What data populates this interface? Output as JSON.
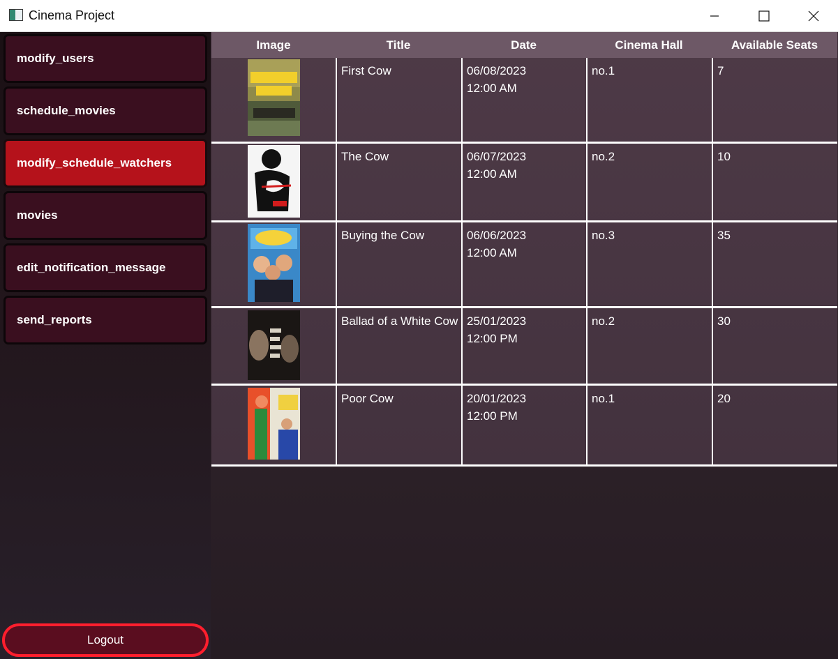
{
  "window": {
    "title": "Cinema Project"
  },
  "sidebar": {
    "items": [
      {
        "label": "modify_users",
        "active": false
      },
      {
        "label": "schedule_movies",
        "active": false
      },
      {
        "label": "modify_schedule_watchers",
        "active": true
      },
      {
        "label": "movies",
        "active": false
      },
      {
        "label": "edit_notification_message",
        "active": false
      },
      {
        "label": "send_reports",
        "active": false
      }
    ],
    "logout_label": "Logout"
  },
  "table": {
    "columns": [
      "Image",
      "Title",
      "Date",
      "Cinema Hall",
      "Available Seats"
    ],
    "rows": [
      {
        "title": "First Cow",
        "date": "06/08/2023",
        "time": "12:00 AM",
        "hall": "no.1",
        "seats": "7"
      },
      {
        "title": "The Cow",
        "date": "06/07/2023",
        "time": "12:00 AM",
        "hall": "no.2",
        "seats": "10"
      },
      {
        "title": "Buying the Cow",
        "date": "06/06/2023",
        "time": "12:00 AM",
        "hall": "no.3",
        "seats": "35"
      },
      {
        "title": "Ballad of a White Cow",
        "date": "25/01/2023",
        "time": "12:00 PM",
        "hall": "no.2",
        "seats": "30"
      },
      {
        "title": "Poor Cow",
        "date": "20/01/2023",
        "time": "12:00 PM",
        "hall": "no.1",
        "seats": "20"
      }
    ]
  },
  "colors": {
    "nav_bg": "#3a0f1f",
    "nav_active_bg": "#b5121b",
    "logout_border": "#ff1e2d",
    "header_bg": "#6d5866"
  }
}
